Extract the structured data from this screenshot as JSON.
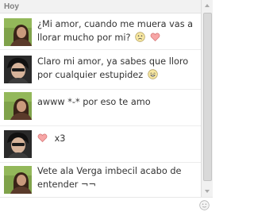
{
  "chat": {
    "date_label": "Hoy",
    "messages": [
      {
        "sender": "girl",
        "text": "¿Mi amor, cuando me muera vas a llorar mucho por mi?",
        "emojis": [
          "sad-face-icon",
          "heart-icon"
        ]
      },
      {
        "sender": "boy",
        "text": "Claro mi amor, ya sabes que lloro por cualquier estupidez",
        "emojis": [
          "grin-face-icon"
        ]
      },
      {
        "sender": "girl",
        "text": "awww *-* por eso te amo",
        "emojis": []
      },
      {
        "sender": "boy",
        "text": "x3",
        "emojis": [
          "heart-icon"
        ]
      },
      {
        "sender": "girl",
        "text": "Vete ala Verga imbecil acabo de entender ¬¬",
        "emojis": []
      }
    ]
  },
  "colors": {
    "text": "#333333",
    "header_bg": "#f2f2f2",
    "header_text": "#7f7f7f",
    "divider": "#ececec",
    "heart_fill": "#f7a6a6",
    "heart_stroke": "#d77b7b",
    "emoji_yellow": "#f7e7a1"
  }
}
